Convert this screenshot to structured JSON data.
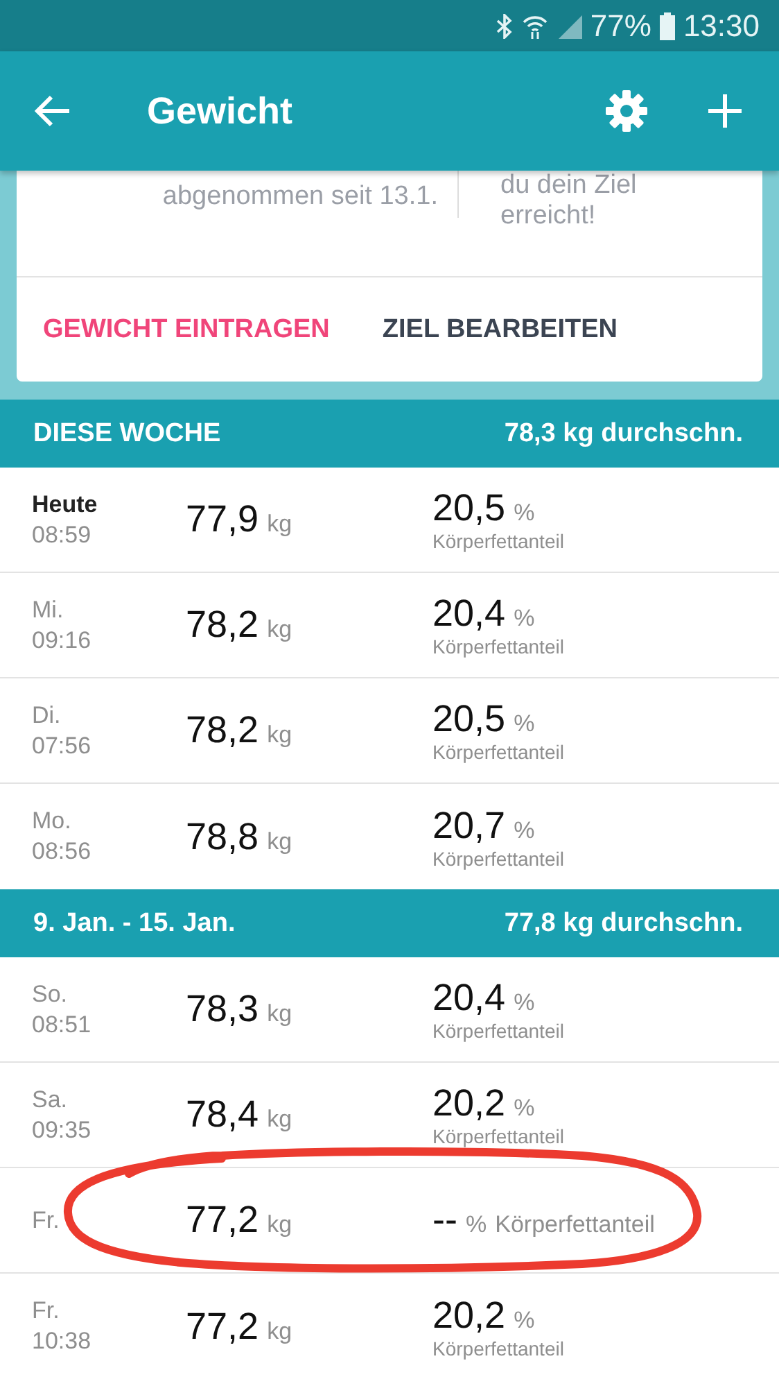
{
  "status_bar": {
    "battery": "77%",
    "time": "13:30"
  },
  "app_bar": {
    "title": "Gewicht"
  },
  "goal_card": {
    "left_text": "abgenommen seit 13.1.",
    "right_text": "du dein Ziel erreicht!",
    "actions": [
      {
        "label": "GEWICHT EINTRAGEN",
        "primary": true
      },
      {
        "label": "ZIEL BEARBEITEN",
        "primary": false
      }
    ]
  },
  "sections": [
    {
      "title": "DIESE WOCHE",
      "average": "78,3 kg durchschn.",
      "rows": [
        {
          "kind": "stacked",
          "day": "Heute",
          "today": true,
          "time": "08:59",
          "weight": "77,9",
          "weight_unit": "kg",
          "fat": "20,5",
          "fat_unit": "%",
          "fat_label": "Körperfettanteil"
        },
        {
          "kind": "stacked",
          "day": "Mi.",
          "today": false,
          "time": "09:16",
          "weight": "78,2",
          "weight_unit": "kg",
          "fat": "20,4",
          "fat_unit": "%",
          "fat_label": "Körperfettanteil"
        },
        {
          "kind": "stacked",
          "day": "Di.",
          "today": false,
          "time": "07:56",
          "weight": "78,2",
          "weight_unit": "kg",
          "fat": "20,5",
          "fat_unit": "%",
          "fat_label": "Körperfettanteil"
        },
        {
          "kind": "stacked",
          "day": "Mo.",
          "today": false,
          "time": "08:56",
          "weight": "78,8",
          "weight_unit": "kg",
          "fat": "20,7",
          "fat_unit": "%",
          "fat_label": "Körperfettanteil"
        }
      ]
    },
    {
      "title": "9. Jan. - 15. Jan.",
      "average": "77,8 kg durchschn.",
      "rows": [
        {
          "kind": "stacked",
          "day": "So.",
          "today": false,
          "time": "08:51",
          "weight": "78,3",
          "weight_unit": "kg",
          "fat": "20,4",
          "fat_unit": "%",
          "fat_label": "Körperfettanteil"
        },
        {
          "kind": "stacked",
          "day": "Sa.",
          "today": false,
          "time": "09:35",
          "weight": "78,4",
          "weight_unit": "kg",
          "fat": "20,2",
          "fat_unit": "%",
          "fat_label": "Körperfettanteil"
        },
        {
          "kind": "inline",
          "day": "Fr.",
          "today": false,
          "weight": "77,2",
          "weight_unit": "kg",
          "fat": "--",
          "fat_unit": "%",
          "fat_label": "Körperfettanteil"
        },
        {
          "kind": "stacked",
          "day": "Fr.",
          "today": false,
          "time": "10:38",
          "weight": "77,2",
          "weight_unit": "kg",
          "fat": "20,2",
          "fat_unit": "%",
          "fat_label": "Körperfettanteil"
        }
      ]
    }
  ],
  "annotation": {
    "kind": "ellipse"
  }
}
